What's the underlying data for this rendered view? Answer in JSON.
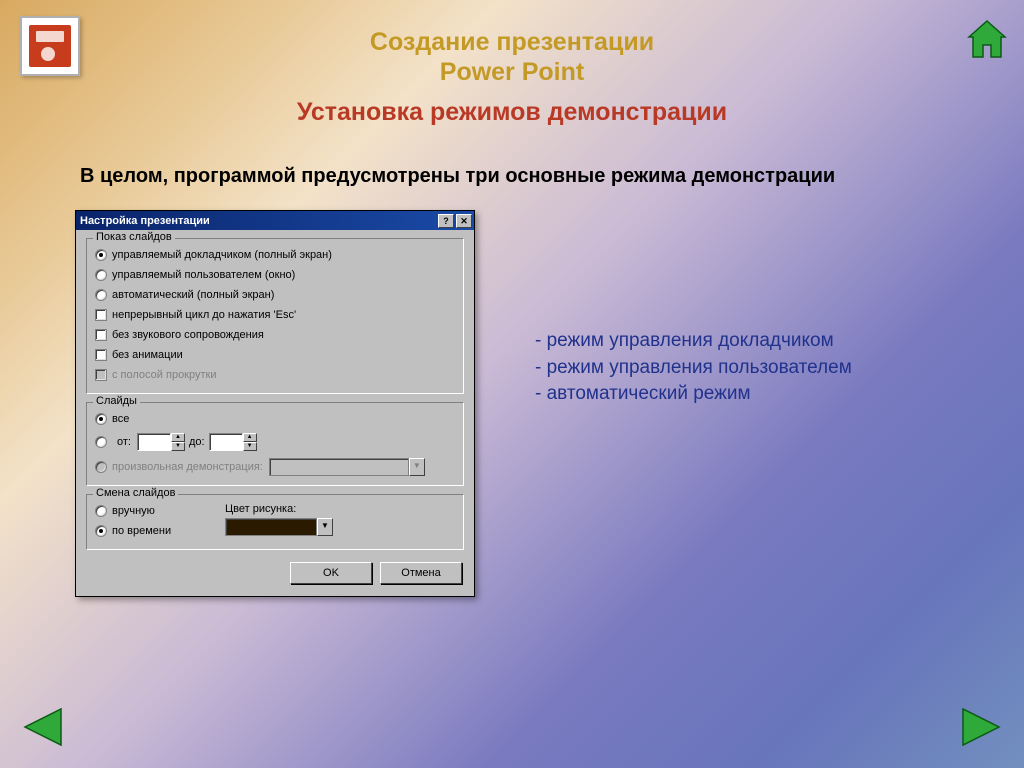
{
  "header": {
    "line1": "Создание презентации",
    "line2": "Power Point",
    "subtitle": "Установка режимов демонстрации"
  },
  "intro": "В целом, программой предусмотрены три основные режима демонстрации",
  "bullets": {
    "b1": "- режим управления докладчиком",
    "b2": "- режим управления пользователем",
    "b3": "- автоматический режим"
  },
  "dialog": {
    "title": "Настройка презентации",
    "group_show": {
      "legend": "Показ слайдов",
      "r1": "управляемый докладчиком (полный экран)",
      "r2": "управляемый пользователем (окно)",
      "r3": "автоматический (полный экран)",
      "c1": "непрерывный цикл до нажатия 'Esc'",
      "c2": "без звукового сопровождения",
      "c3": "без анимации",
      "c4": "с полосой прокрутки"
    },
    "group_slides": {
      "legend": "Слайды",
      "r_all": "все",
      "r_from": "от:",
      "to": "до:",
      "custom": "произвольная демонстрация:"
    },
    "group_change": {
      "legend": "Смена слайдов",
      "r_manual": "вручную",
      "r_time": "по времени",
      "color_label": "Цвет рисунка:"
    },
    "buttons": {
      "ok": "OK",
      "cancel": "Отмена"
    }
  }
}
